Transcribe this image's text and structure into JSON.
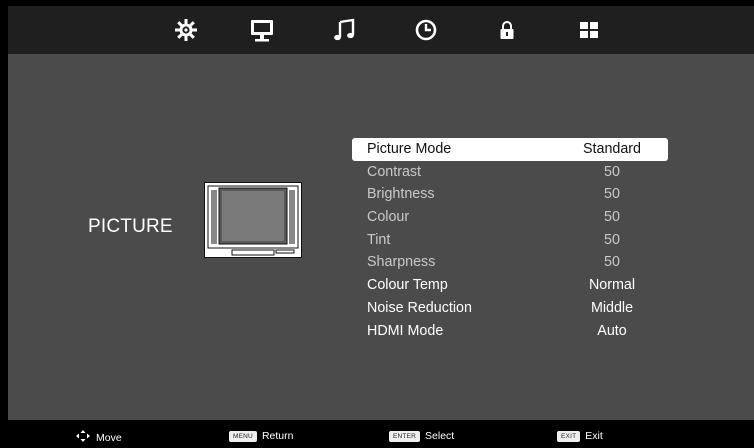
{
  "topbar": {
    "tabs": [
      {
        "icon": "gear-icon"
      },
      {
        "icon": "monitor-icon",
        "active": true
      },
      {
        "icon": "music-note-icon"
      },
      {
        "icon": "clock-icon"
      },
      {
        "icon": "lock-icon"
      },
      {
        "icon": "grid-icon"
      }
    ]
  },
  "section": {
    "title": "PICTURE"
  },
  "menu": {
    "items": [
      {
        "label": "Picture Mode",
        "value": "Standard"
      },
      {
        "label": "Contrast",
        "value": "50"
      },
      {
        "label": "Brightness",
        "value": "50"
      },
      {
        "label": "Colour",
        "value": "50"
      },
      {
        "label": "Tint",
        "value": "50"
      },
      {
        "label": "Sharpness",
        "value": "50"
      },
      {
        "label": "Colour Temp",
        "value": "Normal"
      },
      {
        "label": "Noise Reduction",
        "value": "Middle"
      },
      {
        "label": "HDMI Mode",
        "value": "Auto"
      }
    ]
  },
  "footer": {
    "move": {
      "icon": "navigation-arrows-icon",
      "label": "Move"
    },
    "return": {
      "key": "MENU",
      "label": "Return"
    },
    "select": {
      "key": "ENTER",
      "label": "Select"
    },
    "exit": {
      "key": "EXIT",
      "label": "Exit"
    }
  },
  "colors": {
    "panel": "#4b4b4b",
    "topbar": "#1f1f1f",
    "selected_row": "#ffffff"
  }
}
